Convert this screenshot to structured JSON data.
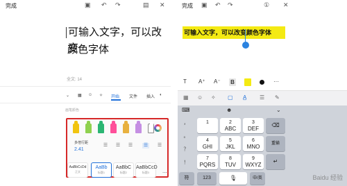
{
  "left_phone": {
    "done_label": "完成",
    "doc_line1": "可输入文字，可以改变",
    "doc_line2": "颜色字体",
    "word_count": "全文: 14",
    "tabs": [
      "开始",
      "文件",
      "插入"
    ],
    "active_tab": "开始",
    "panel_label": "画笔颜色",
    "pen_colors": [
      "#f1c40f",
      "#8fd14f",
      "#2bb673",
      "#ff4f9a",
      "#e8b13f",
      "#c58fe3",
      "#ffffff"
    ],
    "spacing_label": "多倍行距",
    "spacing_value": "2.41",
    "styles": [
      {
        "sample": "AaBbCcDd",
        "name": "正文"
      },
      {
        "sample": "AaBb",
        "name": "标题1"
      },
      {
        "sample": "AaBbC",
        "name": "标题2"
      },
      {
        "sample": "AaBbCcD",
        "name": "标题3"
      }
    ],
    "more_label": "..."
  },
  "right_phone": {
    "done_label": "完成",
    "highlight_text": "可输入文字，可以改变颜色字体",
    "highlight_color": "#f4ea13",
    "format_items": [
      "T",
      "A⁺",
      "A⁻",
      "B"
    ],
    "more_label": "···",
    "keyboard": {
      "top_close": "⌄",
      "left_keys": [
        "，",
        "。",
        "？",
        "！"
      ],
      "rows": [
        [
          {
            "n": "1",
            "l": ""
          },
          {
            "n": "2",
            "l": "ABC"
          },
          {
            "n": "3",
            "l": "DEF"
          }
        ],
        [
          {
            "n": "4",
            "l": "GHI"
          },
          {
            "n": "5",
            "l": "JKL"
          },
          {
            "n": "6",
            "l": "MNO"
          }
        ],
        [
          {
            "n": "7",
            "l": "PQRS"
          },
          {
            "n": "8",
            "l": "TUV"
          },
          {
            "n": "9",
            "l": "WXYZ"
          }
        ]
      ],
      "redo_label": "重输",
      "bottom_left": "符",
      "bottom_num": "123",
      "bottom_lang": "中/英"
    }
  },
  "watermark": "Baidu 经验"
}
